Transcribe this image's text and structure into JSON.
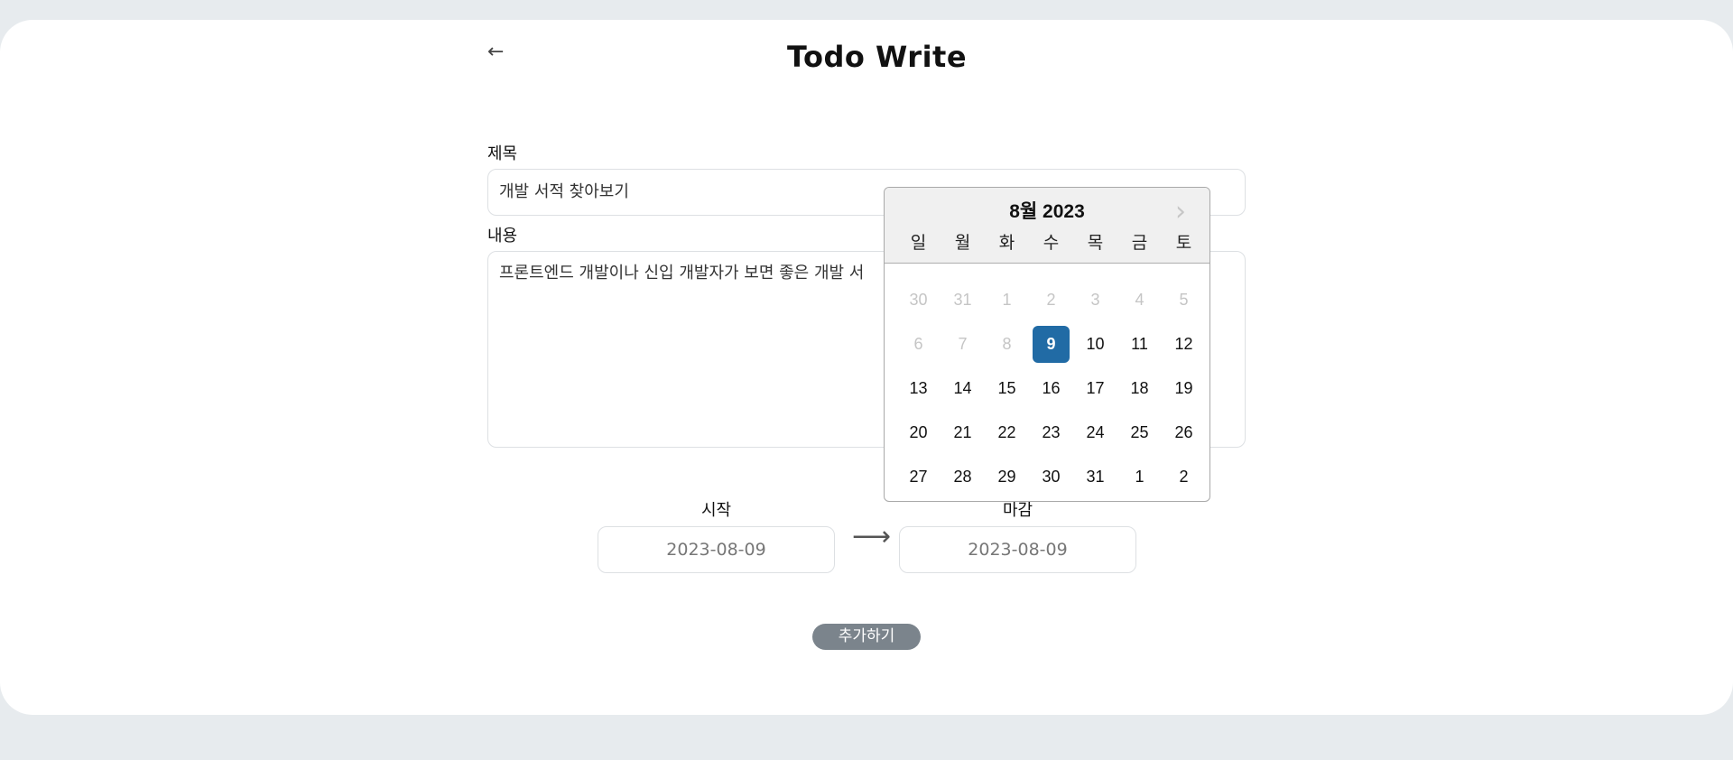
{
  "header": {
    "back_icon": "left-arrow-icon",
    "back_glyph": "←",
    "title": "Todo Write"
  },
  "form": {
    "title_label": "제목",
    "title_value": "개발 서적 찾아보기",
    "content_label": "내용",
    "content_value": "프론트엔드 개발이나 신입 개발자가 보면 좋은 개발 서",
    "start_label": "시작",
    "end_label": "마감",
    "start_value": "2023-08-09",
    "end_value": "2023-08-09",
    "range_arrow_icon": "right-arrow-icon",
    "range_arrow_glyph": "⟶",
    "submit_label": "추가하기",
    "submit_color": "#7b848c"
  },
  "datepicker": {
    "month_label": "8월 2023",
    "next_icon": "chevron-right-icon",
    "next_glyph": "›",
    "weekdays": [
      "일",
      "월",
      "화",
      "수",
      "목",
      "금",
      "토"
    ],
    "selected_color": "#216ba5",
    "weeks": [
      [
        {
          "d": "30",
          "m": true
        },
        {
          "d": "31",
          "m": true
        },
        {
          "d": "1",
          "m": true
        },
        {
          "d": "2",
          "m": true
        },
        {
          "d": "3",
          "m": true
        },
        {
          "d": "4",
          "m": true
        },
        {
          "d": "5",
          "m": true
        }
      ],
      [
        {
          "d": "6",
          "m": true
        },
        {
          "d": "7",
          "m": true
        },
        {
          "d": "8",
          "m": true
        },
        {
          "d": "9",
          "s": true
        },
        {
          "d": "10"
        },
        {
          "d": "11"
        },
        {
          "d": "12"
        }
      ],
      [
        {
          "d": "13"
        },
        {
          "d": "14"
        },
        {
          "d": "15"
        },
        {
          "d": "16"
        },
        {
          "d": "17"
        },
        {
          "d": "18"
        },
        {
          "d": "19"
        }
      ],
      [
        {
          "d": "20"
        },
        {
          "d": "21"
        },
        {
          "d": "22"
        },
        {
          "d": "23"
        },
        {
          "d": "24"
        },
        {
          "d": "25"
        },
        {
          "d": "26"
        }
      ],
      [
        {
          "d": "27"
        },
        {
          "d": "28"
        },
        {
          "d": "29"
        },
        {
          "d": "30"
        },
        {
          "d": "31"
        },
        {
          "d": "1"
        },
        {
          "d": "2"
        }
      ]
    ]
  }
}
